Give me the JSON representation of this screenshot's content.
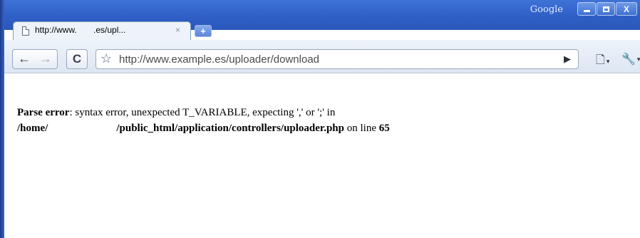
{
  "window": {
    "brand": "Google",
    "controls": {
      "minimize": "",
      "maximize": "",
      "close": "X"
    }
  },
  "tab": {
    "title": "http://www.       .es/upl...",
    "close_glyph": "×",
    "newtab_glyph": "+"
  },
  "toolbar": {
    "back_glyph": "←",
    "forward_glyph": "→",
    "reload_glyph": "C",
    "star_glyph": "☆",
    "url": "http://www.example.es/uploader/download",
    "go_glyph": "▶",
    "page_menu_glyph": "🗋",
    "tools_menu_glyph": "🔧",
    "caret": "▾"
  },
  "error": {
    "label": "Parse error",
    "message": ": syntax error, unexpected T_VARIABLE, expecting ',' or ';' in",
    "path_start": "/home/",
    "path_end": "/public_html/application/controllers/uploader.php",
    "on_line_text": " on line ",
    "line_number": "65"
  }
}
